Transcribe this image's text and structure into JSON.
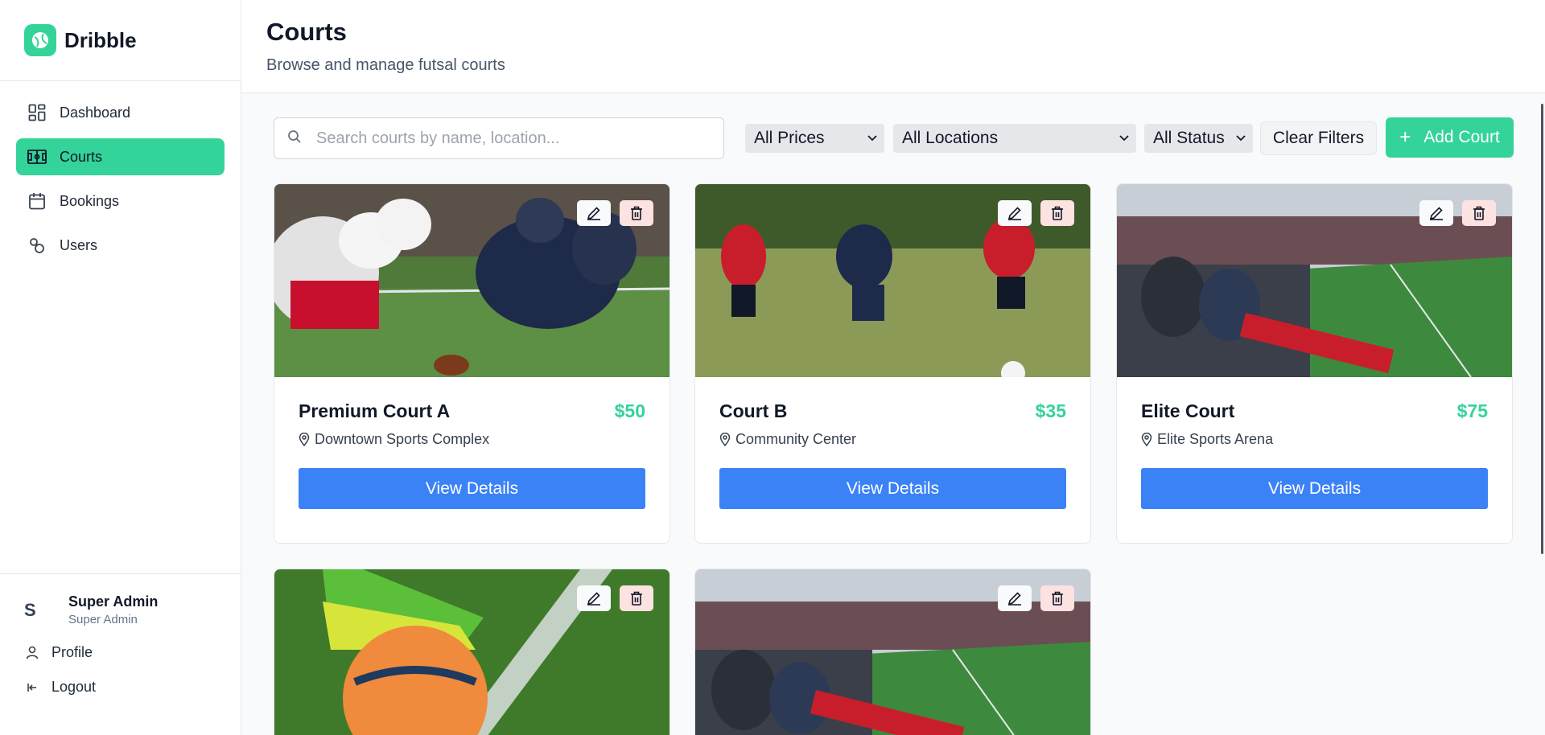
{
  "brand": {
    "name": "Dribble"
  },
  "nav": [
    {
      "label": "Dashboard",
      "icon": "dashboard-icon",
      "active": false
    },
    {
      "label": "Courts",
      "icon": "court-icon",
      "active": true
    },
    {
      "label": "Bookings",
      "icon": "calendar-icon",
      "active": false
    },
    {
      "label": "Users",
      "icon": "users-icon",
      "active": false
    }
  ],
  "user": {
    "initial": "S",
    "name": "Super Admin",
    "role": "Super Admin"
  },
  "footer_links": {
    "profile": "Profile",
    "logout": "Logout"
  },
  "header": {
    "title": "Courts",
    "subtitle": "Browse and manage futsal courts"
  },
  "toolbar": {
    "search_placeholder": "Search courts by name, location...",
    "price_filter": "All Prices",
    "location_filter": "All Locations",
    "status_filter": "All Status",
    "clear_label": "Clear Filters",
    "add_label": "Add Court"
  },
  "courts": [
    {
      "name": "Premium Court A",
      "price": "$50",
      "location": "Downtown Sports Complex",
      "button": "View Details",
      "image": "american-football-line-photo"
    },
    {
      "name": "Court B",
      "price": "$35",
      "location": "Community Center",
      "button": "View Details",
      "image": "soccer-players-photo"
    },
    {
      "name": "Elite Court",
      "price": "$75",
      "location": "Elite Sports Arena",
      "button": "View Details",
      "image": "stadium-crowd-photo"
    },
    {
      "name": "",
      "price": "",
      "location": "",
      "button": "",
      "image": "boot-on-ball-photo"
    },
    {
      "name": "",
      "price": "",
      "location": "",
      "button": "",
      "image": "stadium-crowd-photo"
    }
  ],
  "colors": {
    "accent": "#34d399",
    "primary_button": "#3b82f6",
    "delete_bg": "#fde2e2"
  }
}
